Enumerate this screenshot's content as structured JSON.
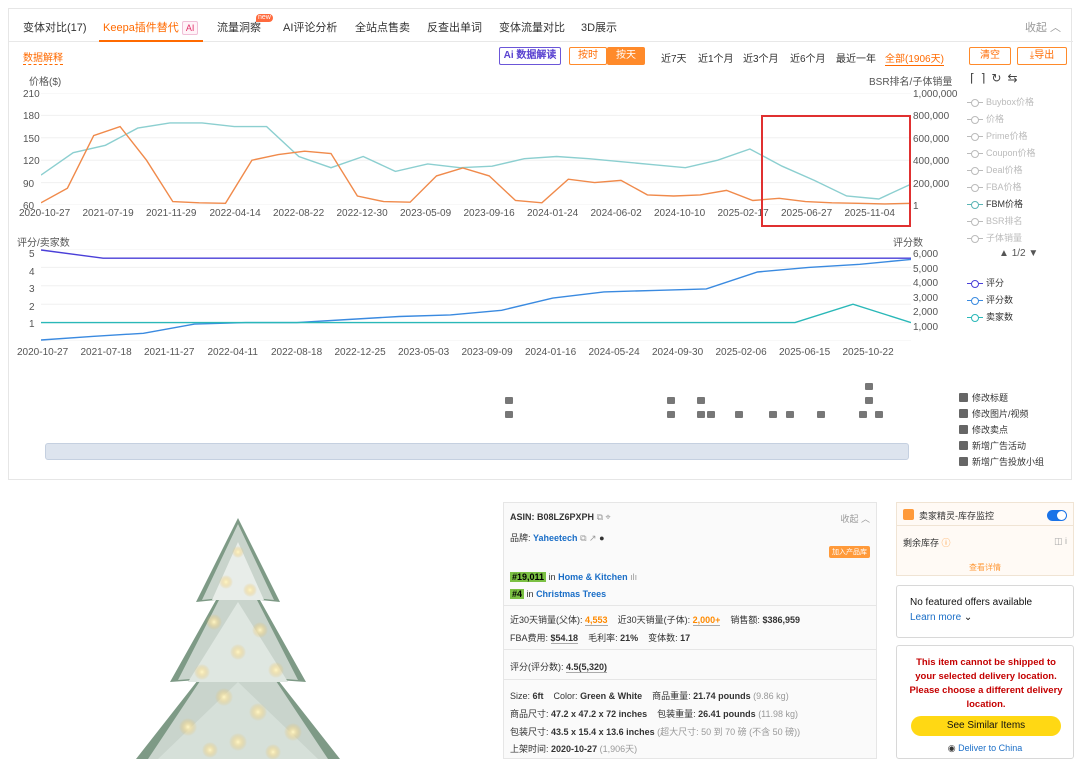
{
  "tabs": [
    {
      "label": "变体对比(17)"
    },
    {
      "label": "Keepa插件替代",
      "badge": "AI"
    },
    {
      "label": "流量洞察",
      "badge": "new"
    },
    {
      "label": "AI评论分析"
    },
    {
      "label": "全站点售卖"
    },
    {
      "label": "反查出单词"
    },
    {
      "label": "变体流量对比"
    },
    {
      "label": "3D展示"
    }
  ],
  "collapse_label": "收起",
  "data_explain": "数据解释",
  "ai_read": "Ai 数据解读",
  "granularity": [
    "按时",
    "按天"
  ],
  "ranges": [
    "近7天",
    "近1个月",
    "近3个月",
    "近6个月",
    "最近一年",
    "全部(1906天)"
  ],
  "actions": {
    "clear": "清空",
    "export": "导出"
  },
  "chart1": {
    "y_left_title": "价格($)",
    "y_right_title": "BSR排名/子体销量",
    "y_left_ticks": [
      "210",
      "180",
      "150",
      "120",
      "90",
      "60"
    ],
    "y_right_ticks": [
      "1,000,000",
      "800,000",
      "600,000",
      "400,000",
      "200,000",
      "1"
    ],
    "x_ticks": [
      "2020-10-27",
      "2021-07-19",
      "2021-11-29",
      "2022-04-14",
      "2022-08-22",
      "2022-12-30",
      "2023-05-09",
      "2023-09-16",
      "2024-01-24",
      "2024-06-02",
      "2024-10-10",
      "2025-02-17",
      "2025-06-27",
      "2025-11-04"
    ]
  },
  "chart2": {
    "y_left_title": "评分/卖家数",
    "y_right_title": "评分数",
    "y_left_ticks": [
      "5",
      "4",
      "3",
      "2",
      "1"
    ],
    "y_right_ticks": [
      "6,000",
      "5,000",
      "4,000",
      "3,000",
      "2,000",
      "1,000"
    ],
    "x_ticks": [
      "2020-10-27",
      "2021-07-18",
      "2021-11-27",
      "2022-04-11",
      "2022-08-18",
      "2022-12-25",
      "2023-05-03",
      "2023-09-09",
      "2024-01-16",
      "2024-05-24",
      "2024-09-30",
      "2025-02-06",
      "2025-06-15",
      "2025-10-22"
    ]
  },
  "legend1": [
    {
      "label": "Buybox价格",
      "active": false
    },
    {
      "label": "价格",
      "active": false
    },
    {
      "label": "Prime价格",
      "active": false
    },
    {
      "label": "Coupon价格",
      "active": false
    },
    {
      "label": "Deal价格",
      "active": false
    },
    {
      "label": "FBA价格",
      "active": false
    },
    {
      "label": "FBM价格",
      "active": true,
      "color": "#5bb5b5"
    },
    {
      "label": "BSR排名",
      "active": false
    },
    {
      "label": "子体销量",
      "active": false
    }
  ],
  "legend_pager": "1/2",
  "legend2": [
    {
      "label": "评分",
      "color": "#4a3fd8"
    },
    {
      "label": "评分数",
      "color": "#3a8ae0"
    },
    {
      "label": "卖家数",
      "color": "#2ab8b8"
    }
  ],
  "event_legend": [
    "修改标题",
    "修改图片/视频",
    "修改卖点",
    "新增广告活动",
    "新增广告投放小组"
  ],
  "chart_data": [
    {
      "type": "line",
      "x_ticks": [
        "2020-10-27",
        "2021-07-19",
        "2021-11-29",
        "2022-04-14",
        "2022-08-22",
        "2022-12-30",
        "2023-05-09",
        "2023-09-16",
        "2024-01-24",
        "2024-06-02",
        "2024-10-10",
        "2025-02-17",
        "2025-06-27",
        "2025-11-04"
      ],
      "ylabel": "价格($)",
      "y2label": "BSR排名/子体销量",
      "ylim": [
        60,
        210
      ],
      "y2lim": [
        1,
        1000000
      ],
      "series": [
        {
          "name": "FBM价格",
          "axis": "left",
          "color": "#8ccfd0",
          "values": [
            100,
            130,
            140,
            163,
            170,
            170,
            165,
            165,
            125,
            110,
            125,
            105,
            115,
            110,
            112,
            122,
            125,
            122,
            118,
            114,
            110,
            120,
            135,
            112,
            93,
            72,
            68,
            88
          ]
        },
        {
          "name": "BSR排名",
          "axis": "right",
          "color": "#f08a4b",
          "values": [
            20000,
            150000,
            620000,
            700000,
            400000,
            30000,
            20000,
            15000,
            400000,
            450000,
            480000,
            460000,
            80000,
            30000,
            25000,
            260000,
            330000,
            260000,
            40000,
            20000,
            230000,
            200000,
            220000,
            90000,
            80000,
            90000,
            130000,
            40000,
            60000,
            30000,
            20000,
            15000,
            10000,
            15000
          ]
        }
      ]
    },
    {
      "type": "line",
      "x_ticks": [
        "2020-10-27",
        "2021-07-18",
        "2021-11-27",
        "2022-04-11",
        "2022-08-18",
        "2022-12-25",
        "2023-05-03",
        "2023-09-09",
        "2024-01-16",
        "2024-05-24",
        "2024-09-30",
        "2025-02-06",
        "2025-06-15",
        "2025-10-22"
      ],
      "ylabel": "评分/卖家数",
      "y2label": "评分数",
      "ylim": [
        0,
        5
      ],
      "y2lim": [
        0,
        6000
      ],
      "series": [
        {
          "name": "评分",
          "axis": "left",
          "color": "#4a3fd8",
          "values": [
            5,
            4.5,
            4.5,
            4.5,
            4.5,
            4.5,
            4.5,
            4.5,
            4.5,
            4.5,
            4.5,
            4.5,
            4.5,
            4.5,
            4.5
          ]
        },
        {
          "name": "评分数",
          "axis": "right",
          "color": "#3a8ae0",
          "values": [
            50,
            300,
            500,
            1100,
            1200,
            1200,
            1400,
            1600,
            1700,
            2000,
            2800,
            3200,
            3300,
            3400,
            4500,
            4800,
            5000,
            5320
          ]
        },
        {
          "name": "卖家数",
          "axis": "left",
          "color": "#2ab8b8",
          "values": [
            1,
            1,
            1,
            1,
            1,
            1,
            1,
            1,
            1,
            1,
            1,
            1,
            1,
            1,
            2,
            1
          ]
        }
      ]
    }
  ],
  "product": {
    "asin_label": "ASIN:",
    "asin": "B08LZ6PXPH",
    "collapse": "收起",
    "brand_label": "品牌:",
    "brand": "Yaheetech",
    "add_tag": "加入产品库",
    "rank1": "#19,011",
    "rank1_in": "in",
    "rank1_cat": "Home & Kitchen",
    "rank2": "#4",
    "rank2_in": "in",
    "rank2_cat": "Christmas Trees",
    "sales_parent_label": "近30天销量(父体):",
    "sales_parent": "4,553",
    "sales_child_label": "近30天销量(子体):",
    "sales_child": "2,000+",
    "revenue_label": "销售额:",
    "revenue": "$386,959",
    "fba_label": "FBA费用:",
    "fba": "$54.18",
    "margin_label": "毛利率:",
    "margin": "21%",
    "variants_label": "变体数:",
    "variants": "17",
    "rating_label": "评分(评分数):",
    "rating": "4.5(5,320)",
    "size_label": "Size:",
    "size": "6ft",
    "color_label": "Color:",
    "color": "Green & White",
    "weight_label": "商品重量:",
    "weight": "21.74 pounds",
    "weight_kg": "(9.86 kg)",
    "dim_label": "商品尺寸:",
    "dim": "47.2 x 47.2 x 72 inches",
    "pkg_weight_label": "包装重量:",
    "pkg_weight": "26.41 pounds",
    "pkg_weight_kg": "(11.98 kg)",
    "pkg_dim_label": "包装尺寸:",
    "pkg_dim": "43.5 x 15.4 x 13.6 inches",
    "pkg_note": "(超大尺寸: 50 到 70 磅 (不含 50 磅))",
    "listed_label": "上架时间:",
    "listed": "2020-10-27",
    "listed_days": "(1,906天)"
  },
  "inventory": {
    "title": "卖家精灵-库存监控",
    "stock_label": "剩余库存",
    "detail": "查看详情"
  },
  "offers": {
    "text": "No featured offers available",
    "learn": "Learn more"
  },
  "shipping": {
    "warning": "This item cannot be shipped to your selected delivery location. Please choose a different delivery location.",
    "button": "See Similar Items",
    "deliver": "Deliver to China"
  }
}
